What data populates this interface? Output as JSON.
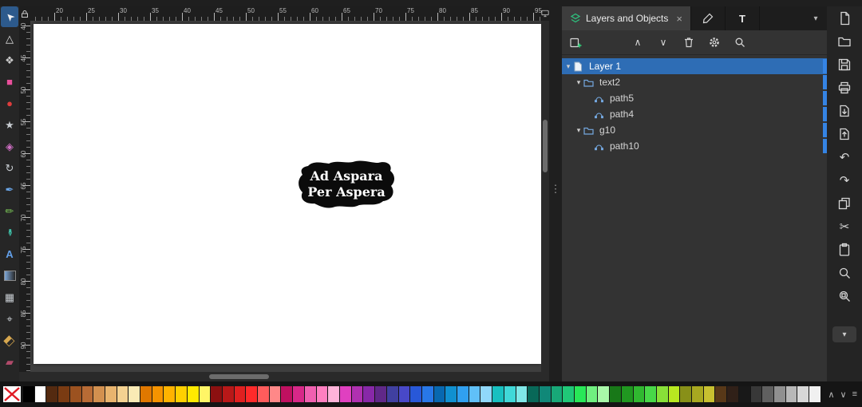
{
  "toolbox": {
    "tools": [
      {
        "name": "selector",
        "glyph": "➤",
        "color": "#f2f2f2",
        "rot": -135,
        "active": true
      },
      {
        "name": "node-editor",
        "glyph": "△",
        "color": "#e0e0e0"
      },
      {
        "name": "shape-builder",
        "glyph": "❖",
        "color": "#c9c9c9"
      },
      {
        "name": "rectangle",
        "glyph": "■",
        "color": "#e84f9b"
      },
      {
        "name": "ellipse",
        "glyph": "●",
        "color": "#dd3d3d"
      },
      {
        "name": "star",
        "glyph": "★",
        "color": "#c6cbd0"
      },
      {
        "name": "box-3d",
        "glyph": "◈",
        "color": "#cf6fc4"
      },
      {
        "name": "spiral",
        "glyph": "↻",
        "color": "#c6cbd0"
      },
      {
        "name": "pen",
        "glyph": "✒",
        "color": "#6aa6e8"
      },
      {
        "name": "pencil",
        "glyph": "✏",
        "color": "#79c457"
      },
      {
        "name": "calligraphy",
        "glyph": "✒",
        "color": "#3fc0a8",
        "rot": 90
      },
      {
        "name": "text",
        "glyph": "A",
        "color": "#62a0ea",
        "bold": true
      },
      {
        "name": "gradient",
        "kind": "gradient"
      },
      {
        "name": "mesh-gradient",
        "glyph": "▦",
        "color": "#c6cbd0"
      },
      {
        "name": "dropper",
        "glyph": "⌖",
        "color": "#c6cbd0"
      },
      {
        "name": "paint-bucket",
        "glyph": "◧",
        "color": "#d8a84f",
        "rot": 45
      },
      {
        "name": "eraser",
        "glyph": "▰",
        "color": "#b04a6a"
      }
    ]
  },
  "rulers": {
    "horizontal_labels": [
      20,
      25,
      30,
      35,
      40,
      45,
      50,
      55,
      60,
      65,
      70,
      75,
      80,
      85,
      90,
      95
    ],
    "vertical_labels": [
      40,
      45,
      50,
      55,
      60,
      65,
      70,
      75,
      80,
      85,
      90
    ]
  },
  "canvas": {
    "sticker_line1": "Ad Aspara",
    "sticker_line2": "Per Aspera"
  },
  "layers_panel": {
    "tab_label": "Layers and Objects",
    "tab_close_glyph": "×",
    "text_tab_label": "T",
    "rows": [
      {
        "label": "Layer 1",
        "type": "layer",
        "indent": 0,
        "expanded": true,
        "selected": true,
        "tag_color": "#3584e4"
      },
      {
        "label": "text2",
        "type": "group",
        "indent": 1,
        "expanded": true,
        "tag_color": "#3584e4"
      },
      {
        "label": "path5",
        "type": "path",
        "indent": 2,
        "tag_color": "#3584e4"
      },
      {
        "label": "path4",
        "type": "path",
        "indent": 2,
        "tag_color": "#3584e4"
      },
      {
        "label": "g10",
        "type": "group",
        "indent": 1,
        "expanded": true,
        "tag_color": "#3584e4"
      },
      {
        "label": "path10",
        "type": "path",
        "indent": 2,
        "tag_color": "#3584e4"
      }
    ]
  },
  "command_bar": {
    "items": [
      "new-document",
      "open-document",
      "save-document",
      "print-document",
      "import",
      "export",
      "undo",
      "redo",
      "duplicate",
      "cut",
      "paste",
      "zoom-drawing",
      "zoom-selection"
    ]
  },
  "palette": {
    "colors": [
      "#000000",
      "#ffffff",
      "#542a10",
      "#7a3b12",
      "#9c5220",
      "#b86b35",
      "#d2904f",
      "#e8b46e",
      "#f4d291",
      "#faeab5",
      "#e07800",
      "#f59300",
      "#ffb300",
      "#ffd000",
      "#ffea00",
      "#fff566",
      "#8c1010",
      "#b81818",
      "#e02020",
      "#ff2a2a",
      "#ff5c5c",
      "#ff8888",
      "#c01060",
      "#d82888",
      "#f060b0",
      "#ff7fc0",
      "#ffb3d9",
      "#e040c0",
      "#b030b0",
      "#8828a8",
      "#602888",
      "#4040a0",
      "#4848c8",
      "#2858d8",
      "#2878e8",
      "#0868b0",
      "#1090d0",
      "#30a0f0",
      "#60c0f8",
      "#90d8fa",
      "#18c0c0",
      "#40d8d8",
      "#80e8e8",
      "#086858",
      "#108878",
      "#18a878",
      "#20c878",
      "#28e858",
      "#70f080",
      "#a8f8a8",
      "#187818",
      "#209820",
      "#30b830",
      "#48d848",
      "#88e038",
      "#b8e820",
      "#889018",
      "#a8a820",
      "#c8c030",
      "#583818",
      "#302018",
      "#181818",
      "#383838",
      "#606060",
      "#909090",
      "#b8b8b8",
      "#d8d8d8",
      "#f0f0f0"
    ]
  },
  "theme": {
    "selection_blue": "#2e6db5",
    "tag_blue": "#3584e4"
  }
}
